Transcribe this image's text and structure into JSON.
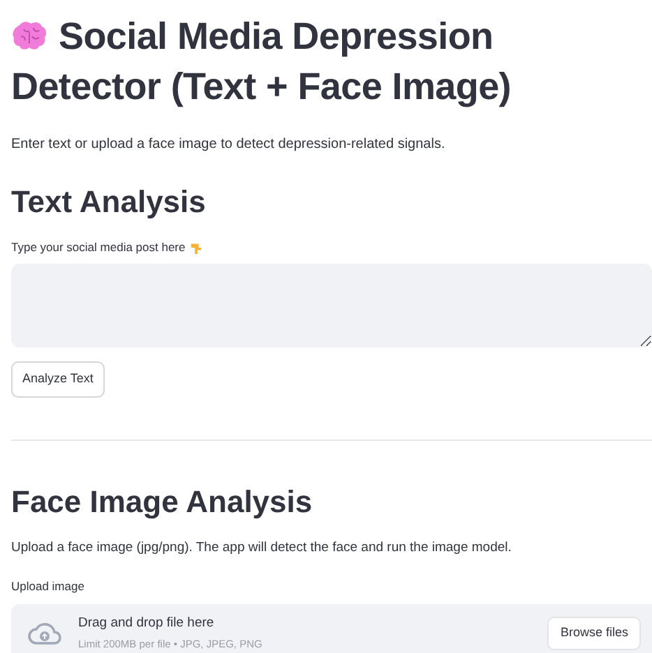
{
  "title": "Social Media Depression Detector (Text + Face Image)",
  "subtitle": "Enter text or upload a face image to detect depression-related signals.",
  "text_analysis": {
    "heading": "Text Analysis",
    "label": "Type your social media post here",
    "button": "Analyze Text"
  },
  "face_analysis": {
    "heading": "Face Image Analysis",
    "description": "Upload a face image (jpg/png). The app will detect the face and run the image model.",
    "upload_label": "Upload image",
    "dropzone_title": "Drag and drop file here",
    "dropzone_hint": "Limit 200MB per file • JPG, JPEG, PNG",
    "button": "Browse files"
  }
}
